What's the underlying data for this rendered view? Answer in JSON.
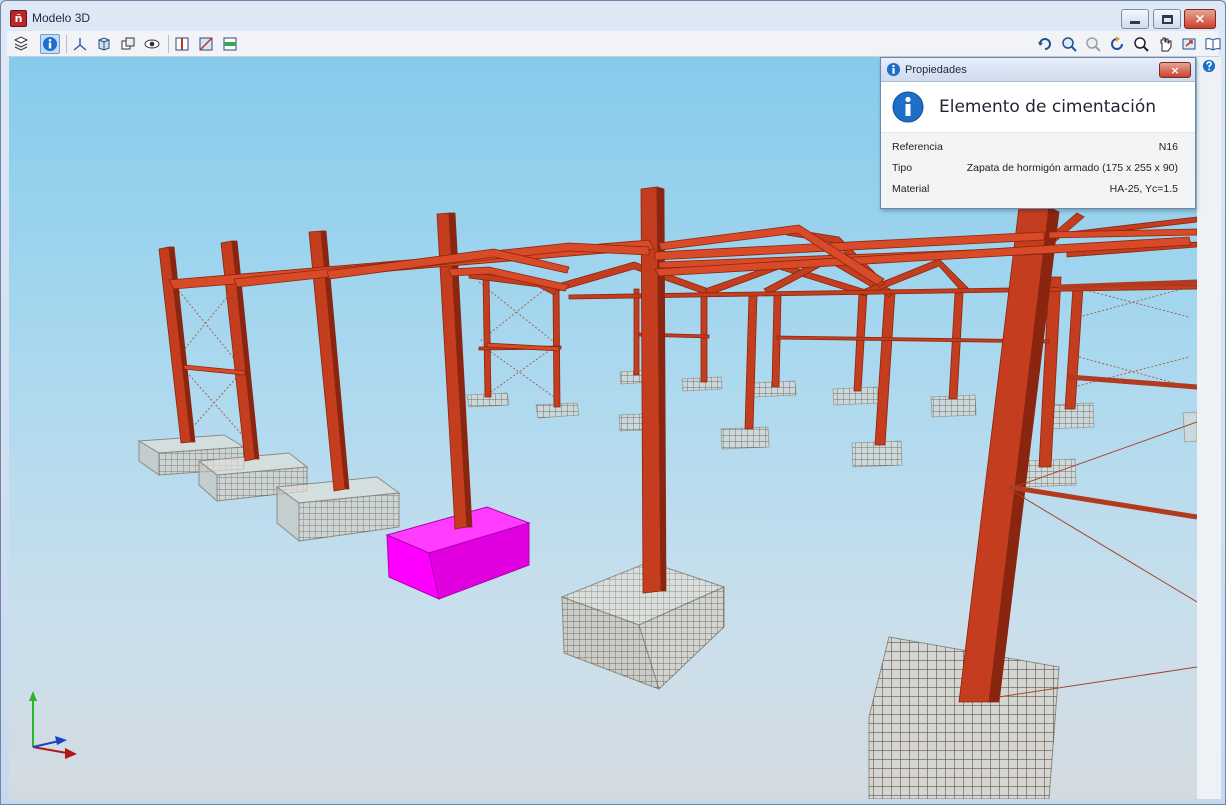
{
  "window": {
    "title": "Modelo 3D",
    "controls": {
      "minimize": "minimize",
      "maximize": "maximize",
      "close": "×"
    }
  },
  "toolbar": {
    "left_tools": [
      {
        "name": "layers-icon",
        "active": false
      },
      {
        "name": "info-icon",
        "active": true
      },
      {
        "name": "axes-icon",
        "active": false
      },
      {
        "name": "solid-view-icon",
        "active": false
      },
      {
        "name": "views-icon",
        "active": false
      },
      {
        "name": "visibility-icon",
        "active": false
      },
      {
        "name": "section-plane-icon",
        "active": false
      },
      {
        "name": "clip-plane-icon",
        "active": false
      },
      {
        "name": "floor-plan-icon",
        "active": false
      }
    ],
    "right_tools": [
      "rotate-icon",
      "zoom-window-icon",
      "zoom-all-icon",
      "refresh-view-icon",
      "zoom-icon",
      "pan-icon",
      "export-icon",
      "book-icon"
    ]
  },
  "right_strip": [
    "help-icon"
  ],
  "properties_panel": {
    "title": "Propiedades",
    "close_label": "×",
    "heading": "Elemento de cimentación",
    "rows": [
      {
        "key": "Referencia",
        "value": "N16"
      },
      {
        "key": "Tipo",
        "value": "Zapata de hormigón armado (175 x 255 x 90)"
      },
      {
        "key": "Material",
        "value": "HA-25, Yc=1.5"
      }
    ]
  },
  "colors": {
    "steel": "#c43d1f",
    "steel_dark": "#8a2610",
    "selected_footing": "#ff00ff",
    "footing": "#d8d8d2",
    "rebar": "#5a3a2a",
    "sky_top": "#86cbeb",
    "sky_bottom": "#d3dbe1",
    "axis_x": "#b01818",
    "axis_y": "#2bb52b",
    "axis_z": "#2040c8"
  }
}
